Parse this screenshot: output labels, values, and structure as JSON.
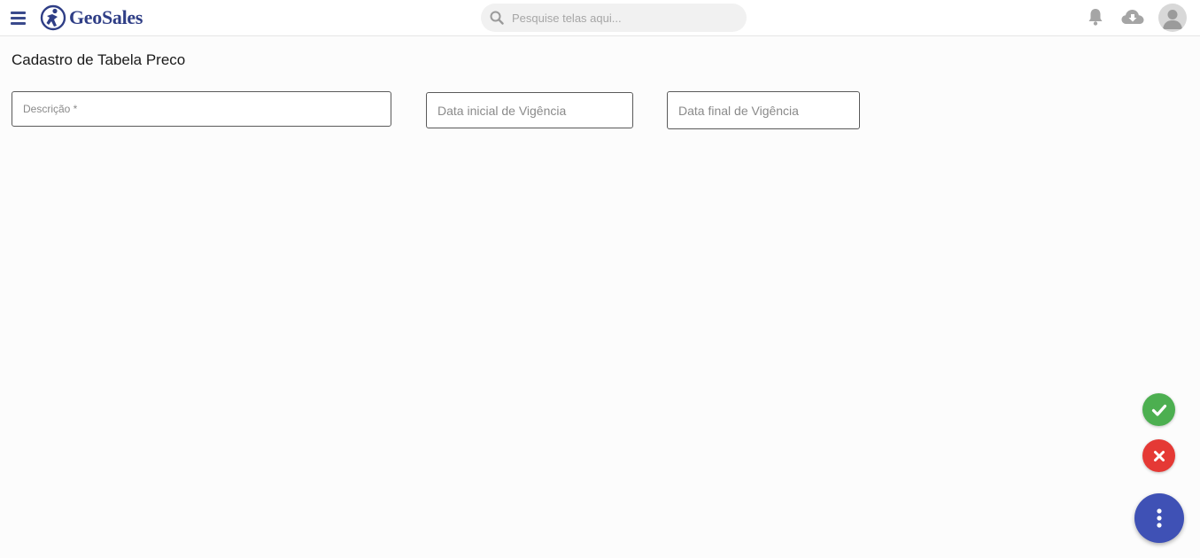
{
  "header": {
    "logo_text": "GeoSales",
    "search": {
      "placeholder": "Pesquise telas aqui...",
      "value": ""
    },
    "icons": [
      "menu-icon",
      "logo-icon",
      "search-icon",
      "bell-icon",
      "cloud-download-icon",
      "user-avatar-icon"
    ]
  },
  "page": {
    "title": "Cadastro de Tabela Preco"
  },
  "form": {
    "descricao": {
      "placeholder": "Descrição *",
      "value": ""
    },
    "data_inicial": {
      "placeholder": "Data inicial de Vigência",
      "value": ""
    },
    "data_final": {
      "placeholder": "Data final de Vigência",
      "value": ""
    }
  },
  "actions": {
    "confirm_icon": "check-icon",
    "cancel_icon": "close-icon",
    "more_icon": "more-vertical-icon"
  },
  "colors": {
    "brand": "#2f3e86",
    "confirm": "#4caf50",
    "cancel": "#e53935",
    "fab": "#3f51b5"
  }
}
